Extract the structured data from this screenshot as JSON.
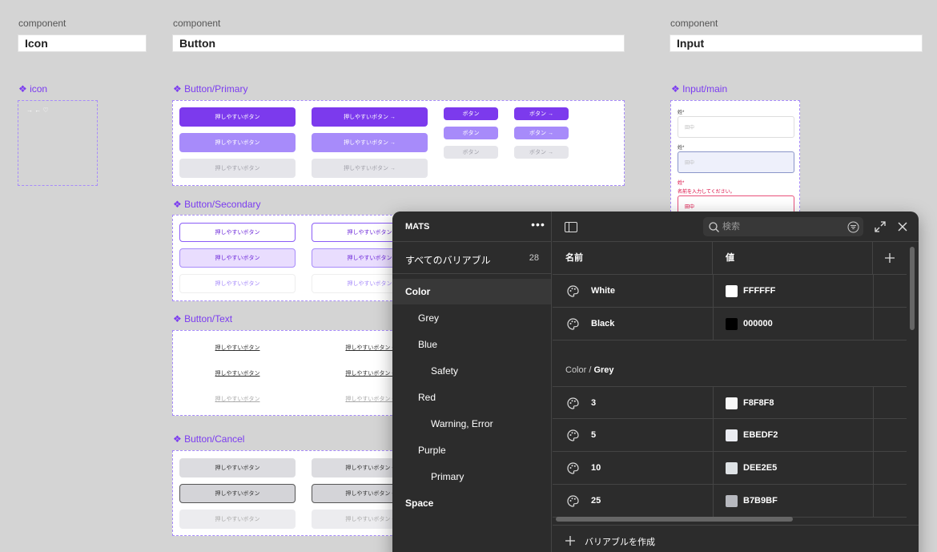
{
  "canvas": {
    "components": [
      {
        "caption": "component",
        "name": "Icon"
      },
      {
        "caption": "component",
        "name": "Button"
      },
      {
        "caption": "component",
        "name": "Input"
      }
    ],
    "frames": {
      "icon": "❖ icon",
      "primary": "❖ Button/Primary",
      "secondary": "❖ Button/Secondary",
      "text": "❖ Button/Text",
      "cancel": "❖ Button/Cancel",
      "input": "❖ Input/main"
    },
    "icon_glyphs": "→ ← ♡",
    "button_label": "押しやすいボタン",
    "button_label_arrow": "押しやすいボタン →",
    "small_button_label": "ボタン",
    "small_button_label_arrow": "ボタン →",
    "text_button_label_arrow": "押しやすいボタン -",
    "input": {
      "label": "姓*",
      "placeholder": "田中",
      "error_message": "名前を入力してください。"
    }
  },
  "panel": {
    "title": "MATS",
    "more_label": "•••",
    "all_variables_label": "すべてのバリアブル",
    "all_variables_count": "28",
    "tree": [
      {
        "label": "Color",
        "level": 0,
        "active": true
      },
      {
        "label": "Grey",
        "level": 1
      },
      {
        "label": "Blue",
        "level": 1
      },
      {
        "label": "Safety",
        "level": 2
      },
      {
        "label": "Red",
        "level": 1
      },
      {
        "label": "Warning, Error",
        "level": 2
      },
      {
        "label": "Purple",
        "level": 1
      },
      {
        "label": "Primary",
        "level": 2
      },
      {
        "label": "Space",
        "level": 0
      }
    ],
    "search_placeholder": "検索",
    "columns": {
      "name": "名前",
      "value": "値"
    },
    "color_rows": [
      {
        "name": "White",
        "hex": "FFFFFF",
        "swatch": "#FFFFFF"
      },
      {
        "name": "Black",
        "hex": "000000",
        "swatch": "#000000"
      }
    ],
    "group": {
      "path": "Color / ",
      "name": "Grey"
    },
    "grey_rows": [
      {
        "name": "3",
        "hex": "F8F8F8",
        "swatch": "#F8F8F8"
      },
      {
        "name": "5",
        "hex": "EBEDF2",
        "swatch": "#EBEDF2"
      },
      {
        "name": "10",
        "hex": "DEE2E5",
        "swatch": "#DEE2E5"
      },
      {
        "name": "25",
        "hex": "B7B9BF",
        "swatch": "#B7B9BF"
      }
    ],
    "create_label": "バリアブルを作成"
  }
}
